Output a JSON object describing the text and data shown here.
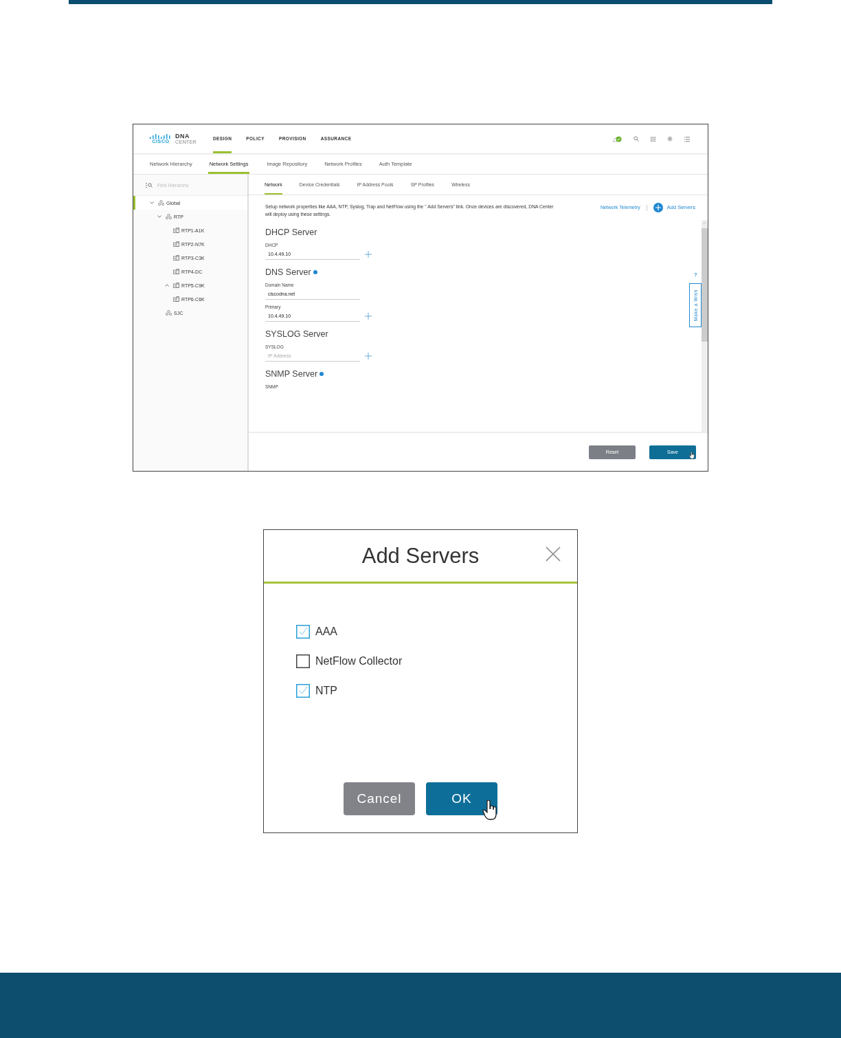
{
  "app": {
    "logo": {
      "wordmark": "CISCO",
      "product": "DNA",
      "subtitle": "CENTER"
    },
    "nav": [
      {
        "label": "DESIGN",
        "selected": true
      },
      {
        "label": "POLICY",
        "selected": false
      },
      {
        "label": "PROVISION",
        "selected": false
      },
      {
        "label": "ASSURANCE",
        "selected": false
      }
    ],
    "subnav": [
      {
        "label": "Network Hierarchy",
        "selected": false
      },
      {
        "label": "Network Settings",
        "selected": true
      },
      {
        "label": "Image Repository",
        "selected": false
      },
      {
        "label": "Network Profiles",
        "selected": false
      },
      {
        "label": "Auth Template",
        "selected": false
      }
    ],
    "search": {
      "placeholder": "Find Hierarchy"
    },
    "tree": [
      {
        "label": "Global",
        "kind": "area",
        "expandable": true,
        "expanded": true,
        "selected": true,
        "children": [
          {
            "label": "RTP",
            "kind": "area",
            "expandable": true,
            "expanded": true,
            "selected": false,
            "children": [
              {
                "label": "RTP1-A1K",
                "kind": "building",
                "expandable": false,
                "selected": false
              },
              {
                "label": "RTP2-N7K",
                "kind": "building",
                "expandable": false,
                "selected": false
              },
              {
                "label": "RTP3-C3K",
                "kind": "building",
                "expandable": false,
                "selected": false
              },
              {
                "label": "RTP4-DC",
                "kind": "building",
                "expandable": false,
                "selected": false
              },
              {
                "label": "RTP5-C9K",
                "kind": "building",
                "expandable": true,
                "expanded": false,
                "selected": false
              },
              {
                "label": "RTP6-C6K",
                "kind": "building",
                "expandable": false,
                "selected": false
              }
            ]
          },
          {
            "label": "SJC",
            "kind": "area",
            "expandable": false,
            "selected": false
          }
        ]
      }
    ],
    "tabs": [
      {
        "label": "Network",
        "selected": true
      },
      {
        "label": "Device Credentials",
        "selected": false
      },
      {
        "label": "IP Address Pools",
        "selected": false
      },
      {
        "label": "SP Profiles",
        "selected": false
      },
      {
        "label": "Wireless",
        "selected": false
      }
    ],
    "description": "Setup network properties like AAA, NTP, Syslog, Trap and NetFlow using the \" Add Servers\" link. Once devices are discovered, DNA Center will deploy using these settings.",
    "telemetry_link": "Network Telemetry",
    "add_servers_link": "Add Servers",
    "sections": [
      {
        "title": "DHCP Server",
        "info": false,
        "fields": [
          {
            "label": "DHCP",
            "value": "10.4.49.10",
            "add": true
          }
        ]
      },
      {
        "title": "DNS Server",
        "info": true,
        "fields": [
          {
            "label": "Domain Name",
            "value": "ciscodna.net",
            "add": false
          },
          {
            "label": "Primary",
            "value": "10.4.49.10",
            "add": true
          }
        ]
      },
      {
        "title": "SYSLOG Server",
        "info": false,
        "fields": [
          {
            "label": "SYSLOG",
            "placeholder": "IP Address",
            "add": true
          }
        ]
      },
      {
        "title": "SNMP Server",
        "info": true,
        "fields": [
          {
            "label": "SNMP"
          }
        ]
      }
    ],
    "help": {
      "question": "?",
      "wish": "Make a Wish"
    },
    "buttons": [
      {
        "label": "Reset",
        "kind": "secondary",
        "cursor": false
      },
      {
        "label": "Save",
        "kind": "primary",
        "cursor": true
      }
    ]
  },
  "dialog": {
    "title": "Add Servers",
    "options": [
      {
        "label": "AAA",
        "checked": true
      },
      {
        "label": "NetFlow Collector",
        "checked": false
      },
      {
        "label": "NTP",
        "checked": true
      }
    ],
    "buttons": [
      {
        "label": "Cancel",
        "kind": "secondary",
        "cursor": false
      },
      {
        "label": "OK",
        "kind": "primary",
        "cursor": true
      }
    ]
  }
}
